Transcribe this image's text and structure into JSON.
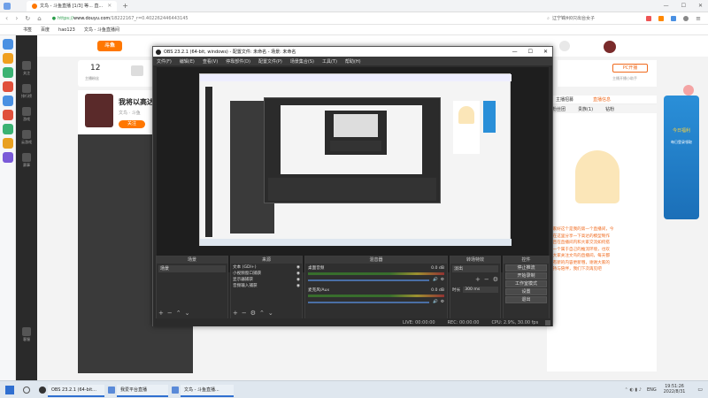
{
  "browser": {
    "tab_title": "文鸟 - 斗鱼直播 [1/3] 等... 直...",
    "address_prefix": "https://",
    "address_domain": "www.douyu.com",
    "address_path": "/18222167_r=0.402262446443145",
    "search_hint": "辽宁锦州0只出台女子",
    "bookmarks": [
      "书签",
      "百度",
      "hao123",
      "文鸟 - 斗鱼直播间"
    ],
    "window_min": "—",
    "window_max": "☐",
    "window_close": "✕"
  },
  "douyu": {
    "logo": "斗鱼",
    "stat_count": "12",
    "stat_label": "主播粉丝",
    "stat_badge": "1",
    "streamer_title": "我将以高达姿",
    "streamer_sub": "文鸟 · 斗鱼",
    "follow_label": "关注",
    "nav": [
      "关注",
      "排行榜",
      "游戏",
      "云游戏",
      "赛事",
      "客服"
    ],
    "right_tabs": [
      "主播招募",
      "直播信息"
    ],
    "right_tabs2": [
      "粉丝团",
      "贵族(1)",
      "钻粉"
    ],
    "pc_broadcast": "PC开播",
    "broadcast_hint": "主播开播小助手",
    "promo_title": "今日福利",
    "promo_sub": "每日登录领取"
  },
  "obs": {
    "title": "OBS 23.2.1 (64-bit, windows) - 配置文件: 未命名 - 场景: 未命名",
    "menu": [
      "文件(F)",
      "编辑(E)",
      "查看(V)",
      "停靠部件(D)",
      "配置文件(P)",
      "场景集合(S)",
      "工具(T)",
      "帮助(H)"
    ],
    "docks": {
      "scenes": {
        "title": "场景",
        "items": [
          "场景"
        ]
      },
      "sources": {
        "title": "来源",
        "items": [
          "文本 (GDI+)",
          "小视频窗口捕获",
          "显示器捕获",
          "音频输入捕获"
        ]
      },
      "mixer": {
        "title": "混音器",
        "channels": [
          {
            "name": "桌面音频",
            "db": "0.0 dB"
          },
          {
            "name": "麦克风/Aux",
            "db": "0.0 dB"
          }
        ]
      },
      "transitions": {
        "title": "转场特效",
        "type": "淡出",
        "duration_label": "时长",
        "duration": "300 ms"
      },
      "controls": {
        "title": "控件",
        "buttons": [
          "停止推流",
          "开始录制",
          "工作室模式",
          "设置",
          "退出"
        ]
      }
    },
    "status": {
      "live": "LIVE: 00:00:00",
      "rec": "REC: 00:00:00",
      "cpu": "CPU: 2.9%, 30.00 fps"
    }
  },
  "article": {
    "lines": [
      "大家好这个是我的第一个直播间，今",
      "天在这里分享一下高达的模型制作",
      "并且在直播间内和大家交流如何搭",
      "建一个属于自己的推流环境，也欢",
      "迎大家关注文鸟的直播间，每天都",
      "会有新的内容更新哦，谢谢大家的",
      "支持与陪伴，我们下次再见吧"
    ]
  },
  "taskbar": {
    "apps": [
      "OBS 23.2.1 (64-bit...",
      "我爱平台直播",
      "文鸟 - 斗鱼直播..."
    ],
    "lang": "ENG",
    "time": "19:51:26",
    "date": "2022/8/31"
  },
  "colors": {
    "accent": "#f06a1d",
    "obs_bg": "#2b2b2b",
    "douyu_orange": "#ff7700"
  }
}
